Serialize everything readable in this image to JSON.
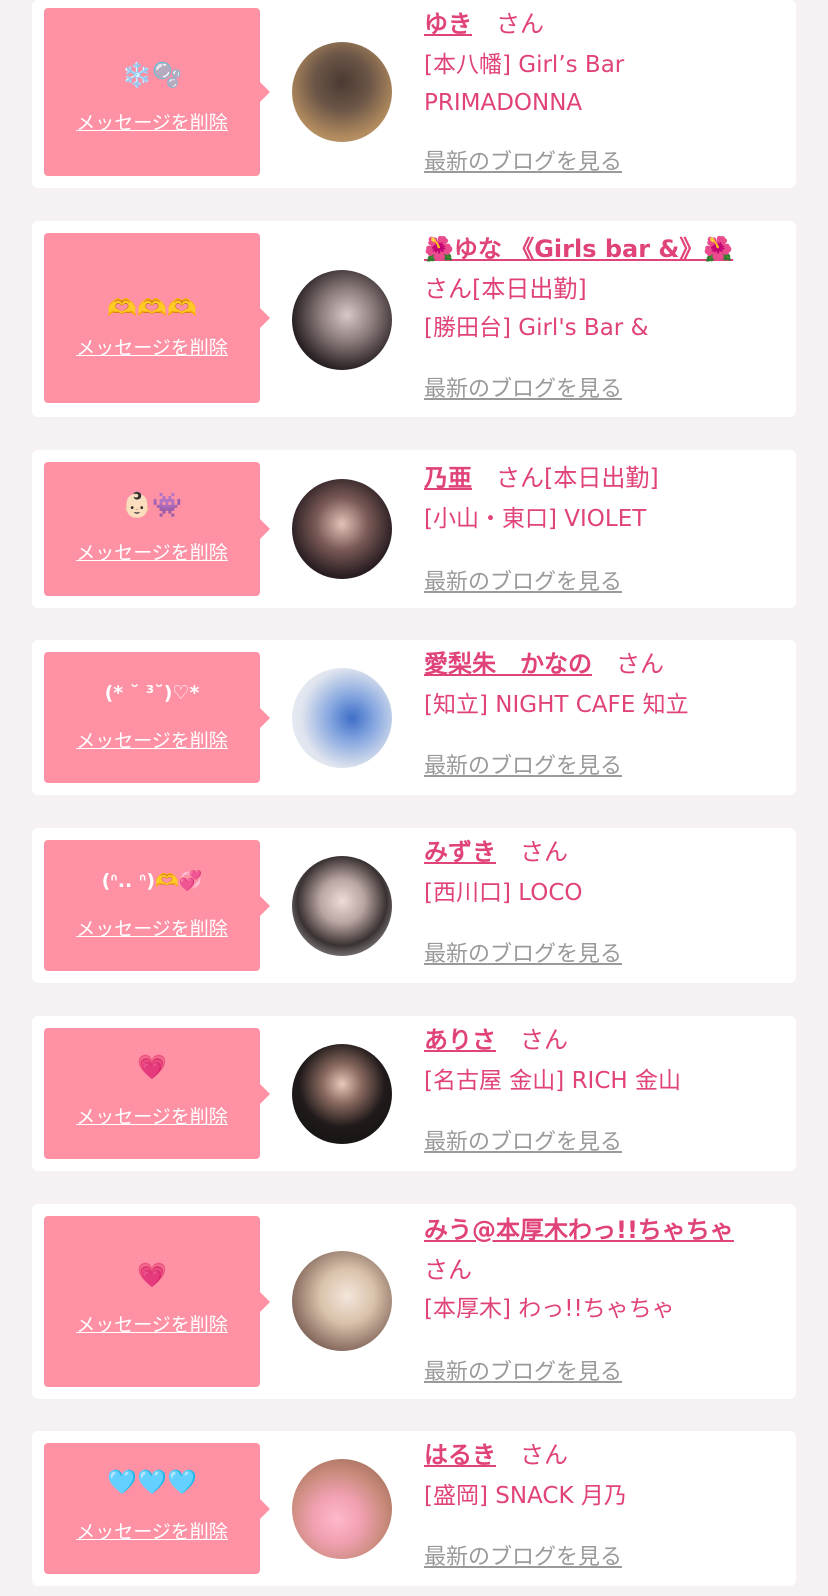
{
  "common": {
    "delete_label": "メッセージを削除",
    "blog_label": "最新のブログを見る",
    "san": "さん"
  },
  "entries": [
    {
      "message": "❄️🫧",
      "name": "ゆき",
      "tag": "",
      "shop": "[本八幡] Girl’s Bar PRIMADONNA"
    },
    {
      "message": "🫶🫶🫶",
      "name": "🌺ゆな 《Girls bar &》🌺",
      "tag": "[本日出勤]",
      "shop": "[勝田台] Girl's Bar &"
    },
    {
      "message": "👶🏻👾",
      "name": "乃亜",
      "tag": "[本日出勤]",
      "shop": "[小山・東口] VIOLET"
    },
    {
      "message": "(* ˘ ³˘)♡*",
      "name": "愛梨朱　かなの",
      "tag": "",
      "shop": "[知立] NIGHT CAFE 知立"
    },
    {
      "message": "(ᐢ.. ᐢ)🫶💞",
      "name": "みずき",
      "tag": "",
      "shop": "[西川口] LOCO"
    },
    {
      "message": "💗",
      "name": "ありさ",
      "tag": "",
      "shop": "[名古屋 金山] RICH 金山"
    },
    {
      "message": "💗",
      "name": "みう@本厚木わっ!!ちゃちゃ",
      "tag": "",
      "shop": "[本厚木] わっ!!ちゃちゃ"
    },
    {
      "message": "🩵🩵🩵",
      "name": "はるき",
      "tag": "",
      "shop": "[盛岡] SNACK 月乃"
    }
  ]
}
